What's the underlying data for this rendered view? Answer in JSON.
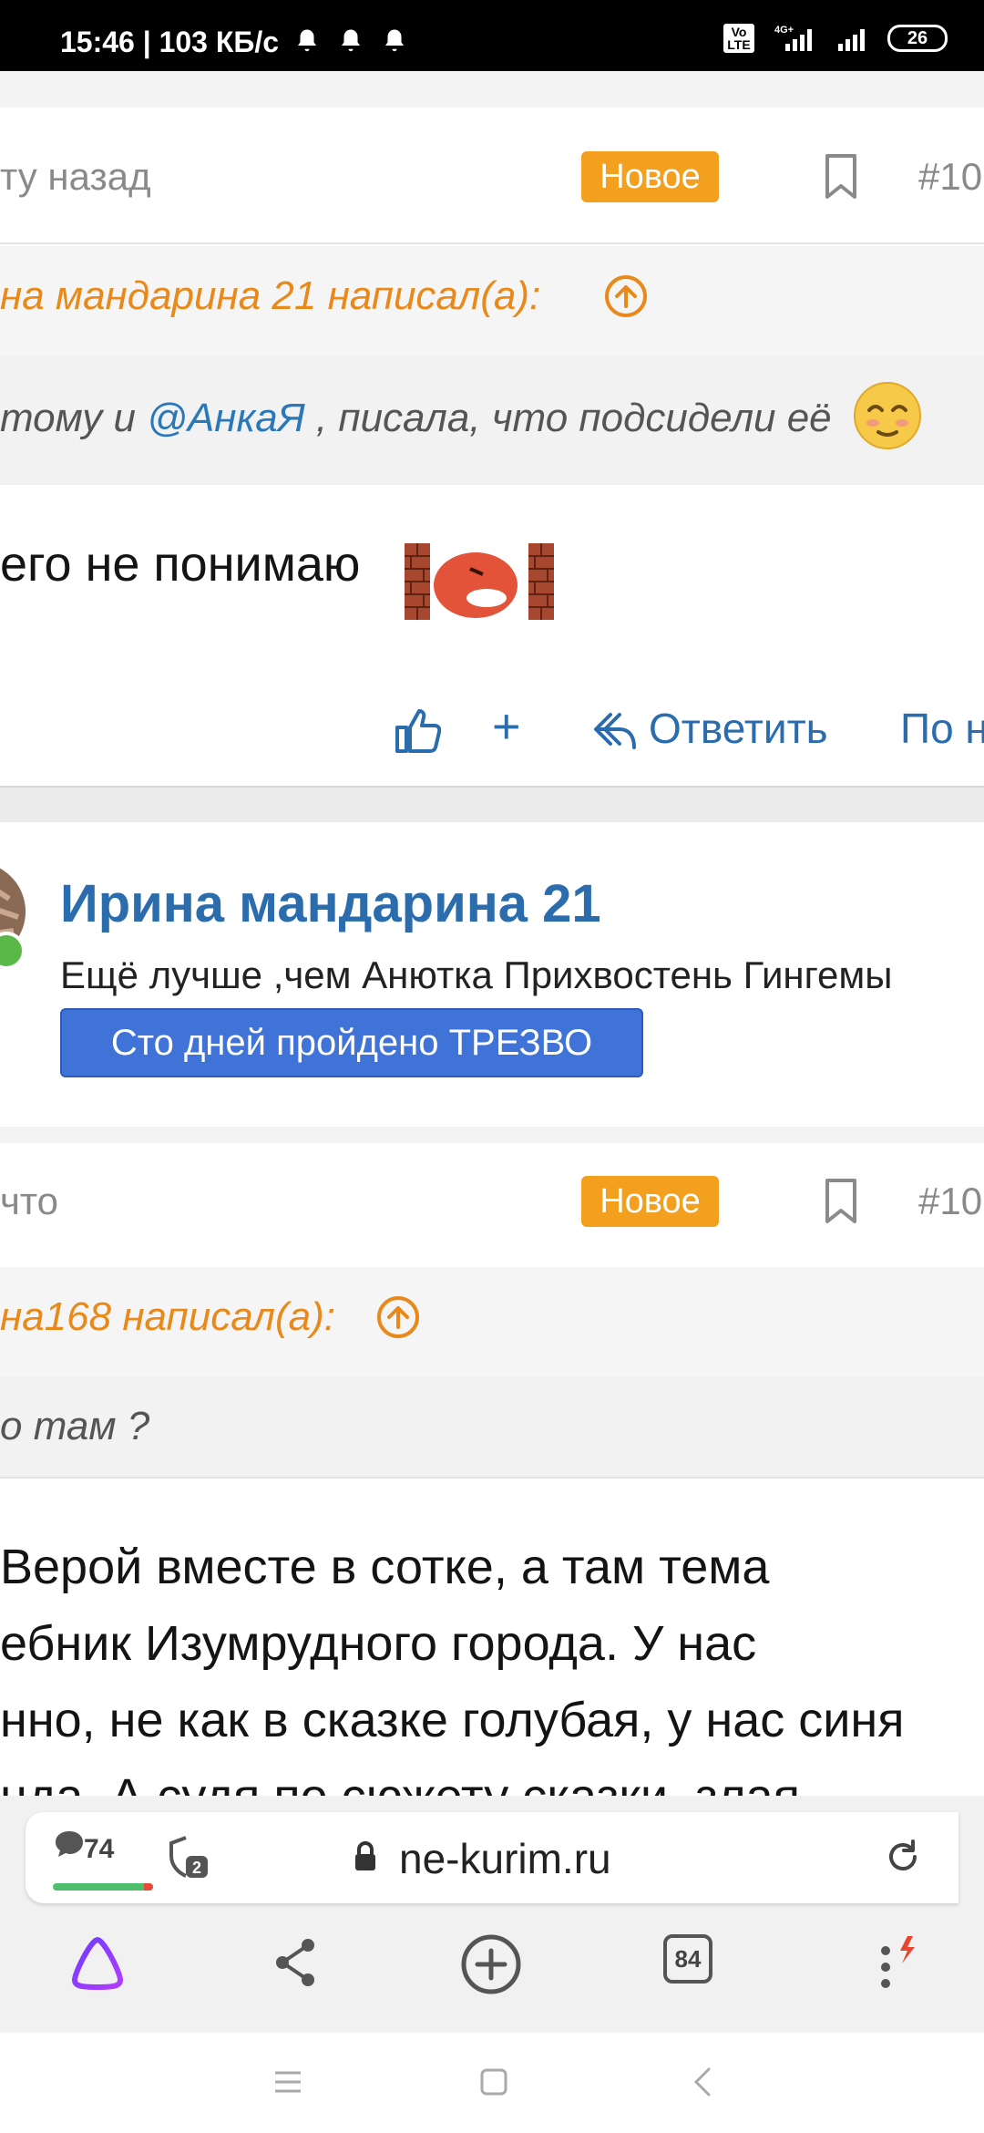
{
  "status_bar": {
    "time": "15:46 | 103 КБ/с",
    "network": "4G+",
    "volte": "Vo LTE",
    "battery": "26"
  },
  "post1": {
    "meta_text": "ту назад",
    "badge": "Новое",
    "post_number": "#10",
    "quote_author": "на мандарина 21 написал(а):",
    "quote_text_before": "тому и ",
    "quote_mention": "@АнкаЯ",
    "quote_text_after": " , писала, что подсидели её",
    "message": "его не понимаю",
    "actions": {
      "plus": "+",
      "reply": "Ответить",
      "more": "По н"
    }
  },
  "post2": {
    "author_name": "Ирина мандарина 21",
    "user_title": "Ещё лучше ,чем Анютка Прихвостень Гингемы",
    "user_badge": "Сто дней пройдено ТРЕЗВО",
    "meta_text": "что",
    "badge": "Новое",
    "post_number": "#10",
    "quote_author": "на168 написал(а):",
    "quote_text": "о там ?",
    "message_lines": [
      " Верой вместе в сотке, а там тема",
      "ебник Изумрудного города. У нас",
      "нно, не как в сказке голубая, у нас синя",
      "нда. А судя по сюжету сказки, злая"
    ]
  },
  "browser": {
    "comments_count": "74",
    "shield_count": "2",
    "url": "ne-kurim.ru",
    "tabs_count": "84"
  },
  "colors": {
    "accent_orange": "#f3a01f",
    "quote_orange": "#e8891a",
    "link_blue": "#2b6cad",
    "badge_blue": "#3f73d8"
  }
}
